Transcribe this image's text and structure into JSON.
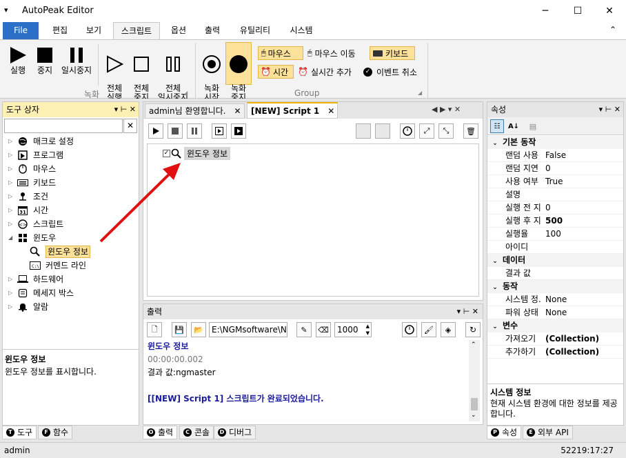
{
  "app": {
    "title": "AutoPeak Editor",
    "menu_glyph": "▾"
  },
  "window_controls": {
    "minimize": "─",
    "maximize": "☐",
    "close": "✕"
  },
  "menu_tabs": [
    "File",
    "편집",
    "보기",
    "스크립트",
    "옵션",
    "출력",
    "유틸리티",
    "시스템"
  ],
  "ribbon": {
    "collapse_glyph": "⌃",
    "record_group": {
      "label": "녹화",
      "buttons": [
        {
          "label": "실행"
        },
        {
          "label": "중지"
        },
        {
          "label": "일시중지"
        },
        {
          "label": "전체\n실행"
        },
        {
          "label": "전체\n중지"
        },
        {
          "label": "전체\n일시중지"
        }
      ]
    },
    "group2": {
      "label": "Group",
      "rec_start": "녹화\n시작",
      "rec_stop": "녹화\n중지",
      "mouse": "마우스",
      "mouse_move": "마우스 이동",
      "keyboard": "키보드",
      "time": "시간",
      "realtime_add": "실시간 추가",
      "event_cancel": "이벤트 취소"
    }
  },
  "toolbox": {
    "title": "도구 상자",
    "pin": "▾  ⊢  ✕",
    "search_clear": "✕",
    "items": [
      {
        "label": "매크로 설정",
        "icon": "globe-icon",
        "expand": "▷"
      },
      {
        "label": "프로그램",
        "icon": "program-icon",
        "expand": "▷"
      },
      {
        "label": "마우스",
        "icon": "mouse-icon",
        "expand": "▷"
      },
      {
        "label": "키보드",
        "icon": "keyboard-icon",
        "expand": "▷"
      },
      {
        "label": "조건",
        "icon": "condition-icon",
        "expand": "▷"
      },
      {
        "label": "시간",
        "icon": "calendar-icon",
        "expand": "▷",
        "icon_text": "31"
      },
      {
        "label": "스크립트",
        "icon": "script-icon",
        "expand": "▷"
      },
      {
        "label": "윈도우",
        "icon": "windows-icon",
        "expand": "◢"
      },
      {
        "label": "윈도우 정보",
        "icon": "magnifier-icon",
        "expand": ""
      },
      {
        "label": "커멘드 라인",
        "icon": "cmd-icon",
        "expand": ""
      },
      {
        "label": "하드웨어",
        "icon": "laptop-icon",
        "expand": "▷"
      },
      {
        "label": "메세지 박스",
        "icon": "messagebox-icon",
        "expand": "▷"
      },
      {
        "label": "알람",
        "icon": "bell-icon",
        "expand": "▷"
      }
    ],
    "desc_title": "윈도우 정보",
    "desc_text": "윈도우 정보를 표시합니다.",
    "tabs": [
      {
        "badge": "T",
        "label": "도구"
      },
      {
        "badge": "F",
        "label": "함수"
      }
    ]
  },
  "editor": {
    "tabs": [
      {
        "label": "admin님 환영합니다.",
        "close": "✕"
      },
      {
        "label": "[NEW] Script 1",
        "close": "✕"
      }
    ],
    "nav": "◀  ▶  ▾  ✕",
    "node_label": "윈도우 정보"
  },
  "output": {
    "title": "출력",
    "controls": "▾  ⊢  ✕",
    "path": "E:\\NGMsoftware\\NG",
    "count": "1000",
    "lines": [
      {
        "text": "윈도우 정보",
        "kind": "header"
      },
      {
        "text": "00:00:00.002",
        "kind": "time"
      },
      {
        "text": "결과 값:ngmaster",
        "kind": "plain"
      },
      {
        "text": "",
        "kind": "blank"
      },
      {
        "text": "[[NEW] Script 1] 스크립트가 완료되었습니다.",
        "kind": "done"
      }
    ],
    "tabs": [
      {
        "badge": "O",
        "label": "출력"
      },
      {
        "badge": "C",
        "label": "콘솔"
      },
      {
        "badge": "D",
        "label": "디버그"
      }
    ]
  },
  "properties": {
    "title": "속성",
    "controls": "▾  ⊢  ✕",
    "categories": [
      {
        "name": "기본 동작",
        "rows": [
          {
            "k": "랜덤 사용",
            "v": "False",
            "bold": false
          },
          {
            "k": "랜덤 지연",
            "v": "0",
            "bold": false
          },
          {
            "k": "사용 여부",
            "v": "True",
            "bold": false
          },
          {
            "k": "설명",
            "v": "",
            "bold": false
          },
          {
            "k": "실행 전 지",
            "v": "0",
            "bold": false
          },
          {
            "k": "실행 후 지",
            "v": "500",
            "bold": true
          },
          {
            "k": "실행율",
            "v": "100",
            "bold": false
          },
          {
            "k": "아이디",
            "v": "",
            "bold": false
          }
        ]
      },
      {
        "name": "데이터",
        "rows": [
          {
            "k": "결과 값",
            "v": "",
            "bold": false
          }
        ]
      },
      {
        "name": "동작",
        "rows": [
          {
            "k": "시스템 정.",
            "v": "None",
            "bold": false
          },
          {
            "k": "파워 상태",
            "v": "None",
            "bold": false
          }
        ]
      },
      {
        "name": "변수",
        "rows": [
          {
            "k": "가져오기",
            "v": "(Collection)",
            "bold": true
          },
          {
            "k": "추가하기",
            "v": "(Collection)",
            "bold": true
          }
        ]
      }
    ],
    "desc_title": "시스템 정보",
    "desc_text": "현재 시스템 환경에 대한 정보를 제공합니다.",
    "tabs": [
      {
        "badge": "P",
        "label": "속성"
      },
      {
        "badge": "E",
        "label": "외부 API"
      }
    ]
  },
  "status": {
    "user": "admin",
    "time": "52219:17:27"
  },
  "colors": {
    "accent": "#2b6fc9",
    "highlight": "#fbe199",
    "arrow": "#e01010",
    "link_blue": "#1a1a9c"
  }
}
